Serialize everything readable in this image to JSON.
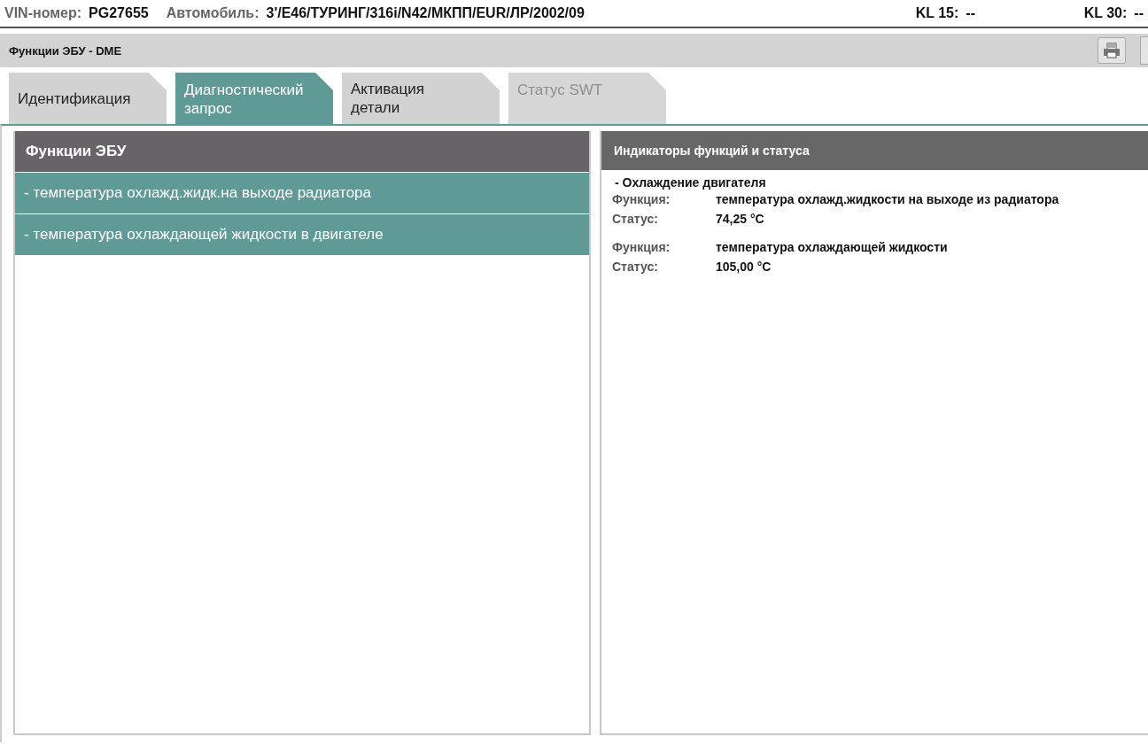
{
  "header": {
    "fields": [
      {
        "label": "VIN-номер:",
        "value": "PG27655"
      },
      {
        "label": "Автомобиль:",
        "value": "3'/E46/ТУРИНГ/316i/N42/МКПП/EUR/ЛР/2002/09"
      }
    ],
    "terminals": [
      {
        "label": "KL 15:",
        "value": "--"
      },
      {
        "label": "KL 30:",
        "value": "--"
      }
    ]
  },
  "title_bar": {
    "title": "Функции ЭБУ - DME"
  },
  "tabs": [
    {
      "label": "Идентификация",
      "selected": false,
      "disabled": false
    },
    {
      "label": "Диагностический запрос",
      "selected": true,
      "disabled": false
    },
    {
      "label": "Активация детали",
      "selected": false,
      "disabled": false
    },
    {
      "label": "Статус SWT",
      "selected": false,
      "disabled": true
    }
  ],
  "functions_panel": {
    "title": "Функции ЭБУ",
    "items": [
      "- температура охлажд.жидк.на выходе радиатора",
      "- температура охлаждающей жидкости в двигателе"
    ]
  },
  "status_panel": {
    "title": "Индикаторы функций и статуса",
    "group": "- Охлаждение двигателя",
    "entries": [
      {
        "function_label": "Функция:",
        "function": "температура охлажд.жидкости на выходе из радиатора",
        "status_label": "Статус:",
        "status": "74,25  °C"
      },
      {
        "function_label": "Функция:",
        "function": "температура охлаждающей жидкости",
        "status_label": "Статус:",
        "status": "105,00  °C"
      }
    ]
  }
}
